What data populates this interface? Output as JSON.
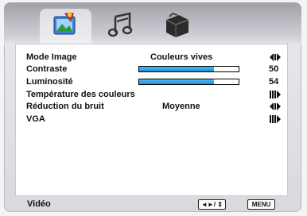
{
  "tabs": [
    {
      "name": "picture-tab",
      "icon": "picture-icon",
      "selected": true
    },
    {
      "name": "sound-tab",
      "icon": "music-notes-icon",
      "selected": false
    },
    {
      "name": "setup-tab",
      "icon": "toolbox-icon",
      "selected": false
    }
  ],
  "menu": {
    "mode_image": {
      "label": "Mode Image",
      "value": "Couleurs vives"
    },
    "contraste": {
      "label": "Contraste",
      "value": "50",
      "level": 0.75
    },
    "luminosite": {
      "label": "Luminosité",
      "value": "54",
      "level": 0.75
    },
    "temperature": {
      "label": "Température des couleurs"
    },
    "reduction": {
      "label": "Réduction du bruit",
      "value": "Moyenne"
    },
    "vga": {
      "label": "VGA"
    }
  },
  "footer": {
    "section": "Vidéo",
    "nav_hint": "◄►/ ⇕",
    "menu_button": "MENU"
  },
  "colors": {
    "bar_fill": "#2ea3ea",
    "panel": "#ffffff",
    "frame": "#dcdce2"
  }
}
